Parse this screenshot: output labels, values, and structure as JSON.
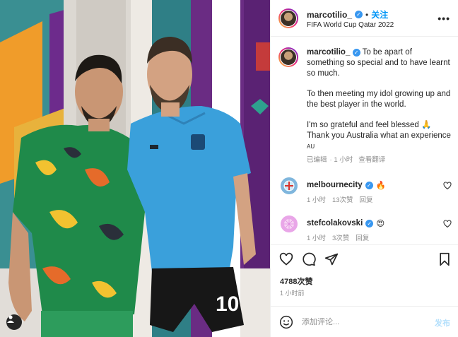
{
  "post": {
    "username": "marcotilio_",
    "follow_label": "关注",
    "dot": "•",
    "location": "FIFA World Cup Qatar 2022",
    "more_label": "•••",
    "caption_p1": "To be apart of something so special and to have learnt so much.",
    "caption_p2": "To then meeting my idol growing up and the best player in the world.",
    "caption_p3a": "I'm so grateful and feel blessed 🙏",
    "caption_p3b": "Thank you Australia what an experience",
    "caption_flag": "AU",
    "edited_label": "已编辑",
    "dot_small": "·",
    "caption_time": "1 小时",
    "see_translation": "查看翻译",
    "likes": "4788次赞",
    "posted_ago": "1 小时前"
  },
  "comments": [
    {
      "username": "melbournecity",
      "emoji": "🔥",
      "time": "1 小时",
      "likes": "13次赞",
      "reply": "回复",
      "avatar_color": "#7fb6dd"
    },
    {
      "username": "stefcolakovski",
      "emoji": "😍",
      "time": "1 小时",
      "likes": "3次赞",
      "reply": "回复",
      "avatar_color": "#e9a6e8"
    }
  ],
  "composer": {
    "placeholder": "添加评论...",
    "post_label": "发布"
  },
  "icons": {
    "verified": "✓",
    "actions": [
      "heart-icon",
      "comment-icon",
      "share-icon",
      "bookmark-icon"
    ]
  },
  "colors": {
    "accent": "#0095f6",
    "verified": "#3897f0",
    "muted": "#8e8e8e"
  }
}
